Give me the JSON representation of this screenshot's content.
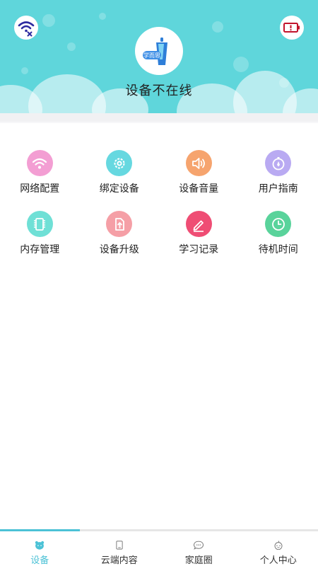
{
  "header": {
    "device_title": "设备不在线",
    "avatar_badge": "学而思",
    "colors": {
      "background": "#5fd6db",
      "wifi": "#2d2aa0",
      "battery": "#c2132b"
    }
  },
  "grid": {
    "rows": [
      [
        {
          "label": "网络配置",
          "icon": "wifi-icon",
          "color": "#f39ed3"
        },
        {
          "label": "绑定设备",
          "icon": "gear-icon",
          "color": "#66d8e0"
        },
        {
          "label": "设备音量",
          "icon": "speaker-icon",
          "color": "#f6a46e"
        },
        {
          "label": "用户指南",
          "icon": "compass-icon",
          "color": "#b9aaf2"
        }
      ],
      [
        {
          "label": "内存管理",
          "icon": "chip-icon",
          "color": "#6fe0d6"
        },
        {
          "label": "设备升级",
          "icon": "upgrade-icon",
          "color": "#f59fa6"
        },
        {
          "label": "学习记录",
          "icon": "pen-icon",
          "color": "#ef4d74"
        },
        {
          "label": "待机时间",
          "icon": "clock-icon",
          "color": "#59d39b"
        }
      ]
    ]
  },
  "bottom_progress": 0.25,
  "tabs": [
    {
      "label": "设备",
      "icon": "bear-icon",
      "active": true
    },
    {
      "label": "云端内容",
      "icon": "tablet-icon",
      "active": false
    },
    {
      "label": "家庭圈",
      "icon": "chat-icon",
      "active": false
    },
    {
      "label": "个人中心",
      "icon": "profile-icon",
      "active": false
    }
  ],
  "accent_color": "#4cc2d6"
}
